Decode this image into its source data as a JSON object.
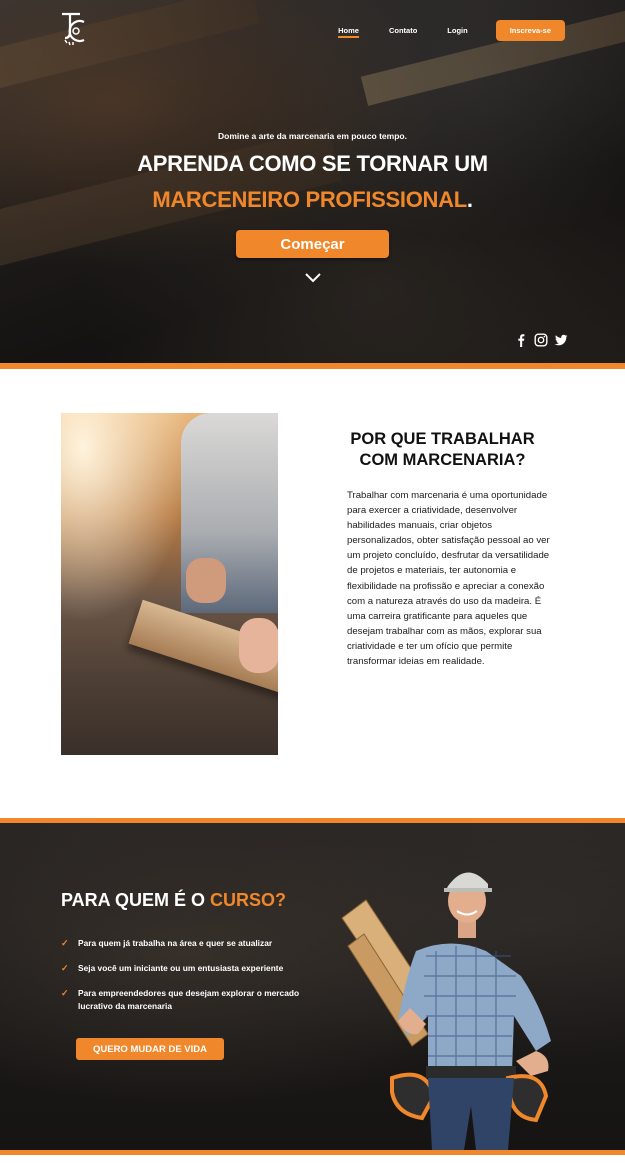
{
  "nav": {
    "items": [
      {
        "label": "Home",
        "active": true
      },
      {
        "label": "Contato",
        "active": false
      },
      {
        "label": "Login",
        "active": false
      }
    ],
    "signup_label": "Inscreva-se"
  },
  "hero": {
    "subtitle": "Domine a arte da marcenaria em pouco tempo.",
    "title_line1": "APRENDA COMO SE TORNAR UM",
    "title_line2_highlight": "MARCENEIRO PROFISSIONAL",
    "title_line2_end": ".",
    "start_label": "Começar",
    "socials": [
      "facebook-icon",
      "instagram-icon",
      "twitter-icon"
    ]
  },
  "why": {
    "title": "POR QUE TRABALHAR COM MARCENARIA?",
    "text": "Trabalhar com marcenaria é uma oportunidade para exercer a criatividade, desenvolver habilidades manuais, criar objetos personalizados, obter satisfação pessoal ao ver um projeto concluído, desfrutar da versatilidade de projetos e materiais, ter autonomia e flexibilidade na profissão e apreciar a conexão com a natureza através do uso da madeira. É uma carreira gratificante para aqueles que desejam trabalhar com as mãos, explorar sua criatividade e ter um ofício que permite transformar ideias em realidade."
  },
  "audience": {
    "title_start": "PARA QUEM É O ",
    "title_highlight": "CURSO?",
    "items": [
      "Para quem já trabalha na área e quer se atualizar",
      "Seja você um iniciante ou um entusiasta experiente",
      "Para empreendedores que desejam explorar o mercado lucrativo da marcenaria"
    ],
    "cta_label": "QUERO MUDAR DE VIDA"
  },
  "colors": {
    "accent": "#f0872b",
    "dark": "#1c1a19",
    "text": "#1c1c1c"
  }
}
